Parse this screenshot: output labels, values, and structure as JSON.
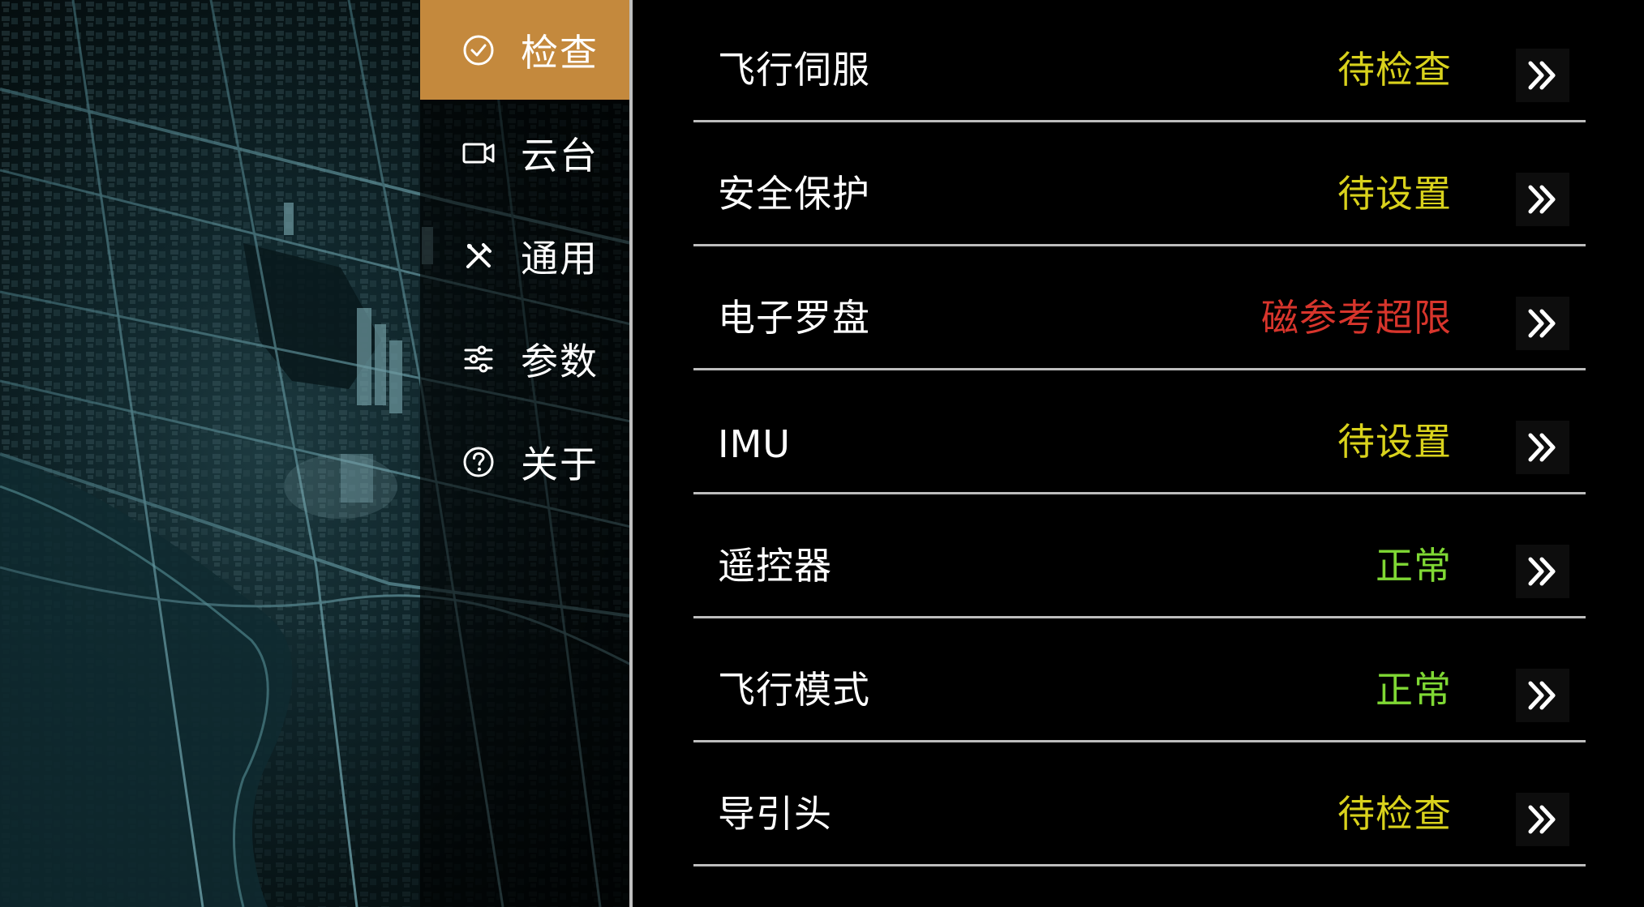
{
  "colors": {
    "accent": "#c4893d",
    "pending": "#d9d21c",
    "error": "#d8352c",
    "ok": "#7fd834",
    "text": "#ffffff"
  },
  "menu": {
    "items": [
      {
        "label": "检查",
        "icon": "check-circle-icon",
        "active": true
      },
      {
        "label": "云台",
        "icon": "camera-icon",
        "active": false
      },
      {
        "label": "通用",
        "icon": "tools-icon",
        "active": false
      },
      {
        "label": "参数",
        "icon": "sliders-icon",
        "active": false
      },
      {
        "label": "关于",
        "icon": "help-circle-icon",
        "active": false
      }
    ]
  },
  "checks": [
    {
      "name": "飞行伺服",
      "status": "待检查",
      "status_type": "pending"
    },
    {
      "name": "安全保护",
      "status": "待设置",
      "status_type": "pending"
    },
    {
      "name": "电子罗盘",
      "status": "磁参考超限",
      "status_type": "error"
    },
    {
      "name": "IMU",
      "status": "待设置",
      "status_type": "pending"
    },
    {
      "name": "遥控器",
      "status": "正常",
      "status_type": "ok"
    },
    {
      "name": "飞行模式",
      "status": "正常",
      "status_type": "ok"
    },
    {
      "name": "导引头",
      "status": "待检查",
      "status_type": "pending"
    }
  ],
  "row_action_icon": "double-chevron-right-icon"
}
